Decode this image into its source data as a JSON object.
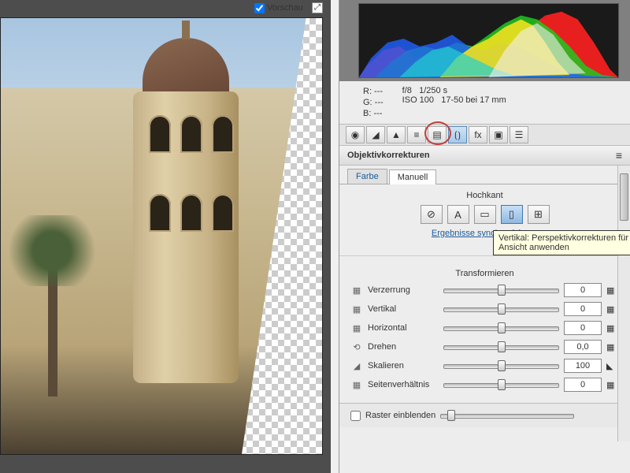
{
  "preview": {
    "label": "Vorschau"
  },
  "meta": {
    "r": "R:  ---",
    "g": "G:  ---",
    "b": "B:  ---",
    "aperture": "f/8",
    "shutter": "1/250 s",
    "iso": "ISO 100",
    "lens": "17-50 bei 17 mm"
  },
  "panel": {
    "title": "Objektivkorrekturen"
  },
  "tabs": {
    "color": "Farbe",
    "manual": "Manuell"
  },
  "upright": {
    "heading": "Hochkant",
    "sync": "Ergebnisse synchronisieren",
    "tooltip_l1": "Vertikal: Perspektivkorrekturen für",
    "tooltip_l2": "Ansicht anwenden"
  },
  "transform": {
    "heading": "Transformieren",
    "rows": [
      {
        "label": "Verzerrung",
        "value": "0",
        "pos": 50
      },
      {
        "label": "Vertikal",
        "value": "0",
        "pos": 50
      },
      {
        "label": "Horizontal",
        "value": "0",
        "pos": 50
      },
      {
        "label": "Drehen",
        "value": "0,0",
        "pos": 50
      },
      {
        "label": "Skalieren",
        "value": "100",
        "pos": 50
      },
      {
        "label": "Seitenverhältnis",
        "value": "0",
        "pos": 50
      }
    ]
  },
  "grid": {
    "label": "Raster einblenden"
  }
}
